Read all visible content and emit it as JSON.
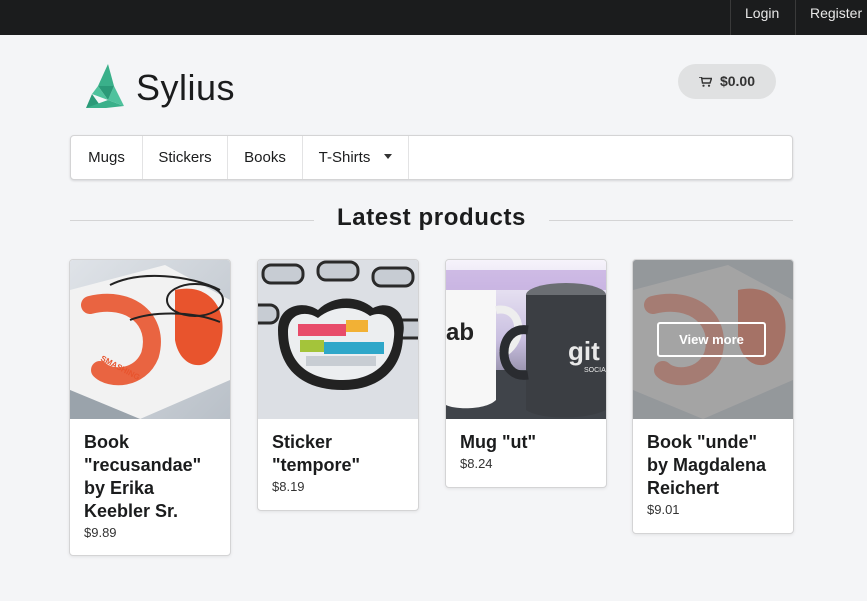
{
  "topbar": {
    "login": "Login",
    "register": "Register"
  },
  "header": {
    "brand": "Sylius",
    "cart_total": "$0.00"
  },
  "menu": {
    "items": [
      "Mugs",
      "Stickers",
      "Books",
      "T-Shirts"
    ]
  },
  "section": {
    "title": "Latest products"
  },
  "products": [
    {
      "name": "Book \"recusandae\" by Erika Keebler Sr.",
      "price": "$9.89"
    },
    {
      "name": "Sticker \"tempore\"",
      "price": "$8.19"
    },
    {
      "name": "Mug \"ut\"",
      "price": "$8.24"
    },
    {
      "name": "Book \"unde\" by Magdalena Reichert",
      "price": "$9.01",
      "overlay_button": "View more"
    }
  ],
  "colors": {
    "brand": "#3ab08a",
    "topbar": "#1b1c1d"
  }
}
